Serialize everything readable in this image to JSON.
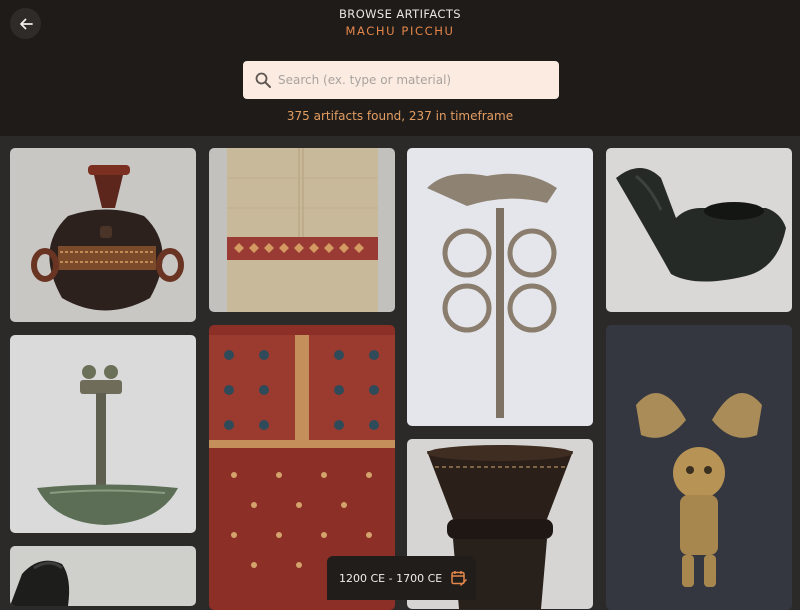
{
  "header": {
    "title": "BROWSE ARTIFACTS",
    "subtitle": "MACHU PICCHU",
    "back_icon": "arrow-left-icon"
  },
  "search": {
    "placeholder": "Search (ex. type or material)",
    "value": "",
    "icon": "search-icon"
  },
  "results": {
    "summary": "375 artifacts found, 237 in timeframe"
  },
  "artifacts": [
    {
      "name": "ceramic aryballos vessel"
    },
    {
      "name": "striped textile fragment"
    },
    {
      "name": "silver figure pin"
    },
    {
      "name": "dark stone animal mortar"
    },
    {
      "name": "bronze tumi knife"
    },
    {
      "name": "red patterned tapestry"
    },
    {
      "name": "wooden kero cup"
    },
    {
      "name": "gold winged figure pendant"
    },
    {
      "name": "dark stone carving"
    }
  ],
  "timeframe": {
    "label": "1200 CE - 1700 CE",
    "icon": "calendar-edit-icon"
  },
  "colors": {
    "header_bg": "#1e1b19",
    "page_bg": "#2b2a29",
    "accent": "#e4864a",
    "search_bg": "#fbebe0"
  }
}
